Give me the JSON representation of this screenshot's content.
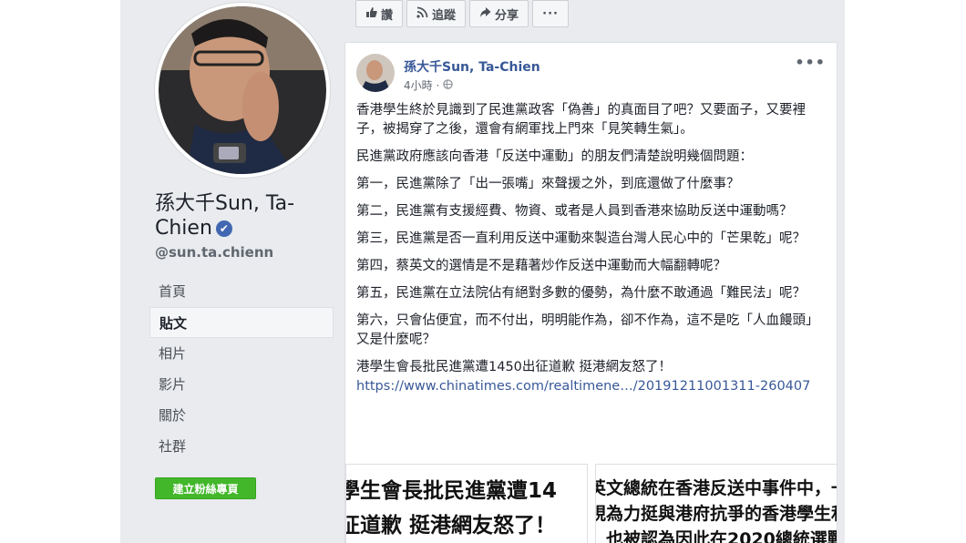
{
  "profile": {
    "name": "孫大千Sun, Ta-Chien",
    "verified_mark": "✔",
    "handle": "@sun.ta.chienn",
    "nav": [
      "首頁",
      "貼文",
      "相片",
      "影片",
      "關於",
      "社群"
    ],
    "active_nav": "貼文",
    "create_page_button": "建立粉絲專頁"
  },
  "actions": {
    "like": "讚",
    "follow": "追蹤",
    "share": "分享",
    "more": "···"
  },
  "post": {
    "author": "孫大千Sun, Ta-Chien",
    "time": "4小時",
    "paragraphs": [
      "香港學生終於見識到了民進黨政客「偽善」的真面目了吧？又要面子，又要裡子，被揭穿了之後，還會有網軍找上門來「見笑轉生氣」。",
      "民進黨政府應該向香港「反送中運動」的朋友們清楚說明幾個問題：",
      "第一，民進黨除了「出一張嘴」來聲援之外，到底還做了什麼事？",
      "第二，民進黨有支援經費、物資、或者是人員到香港來協助反送中運動嗎？",
      "第三，民進黨是否一直利用反送中運動來製造台灣人民心中的「芒果乾」呢？",
      "第四，蔡英文的選情是不是藉著炒作反送中運動而大幅翻轉呢？",
      "第五，民進黨在立法院佔有絕對多數的優勢，為什麼不敢通過「難民法」呢？",
      "第六，只會佔便宜，而不付出，明明能作為，卻不作為，這不是吃「人血饅頭」又是什麼呢？"
    ],
    "headline": "港學生會長批民進黨遭1450出征道歉 挺港網友怒了！",
    "link": "https://www.chinatimes.com/realtimene…/20191211001311-260407",
    "preview_left": [
      "學生會長批民進黨遭14",
      "征道歉 挺港網友怒了！"
    ],
    "preview_right": [
      "英文總統在香港反送中事件中，一",
      "視為力挺與港府抗爭的香港學生和",
      "，也被認為因此在2020總統選戰中"
    ]
  },
  "colors": {
    "link": "#385898",
    "create_button": "#42b72a",
    "verified": "#4267b2"
  }
}
